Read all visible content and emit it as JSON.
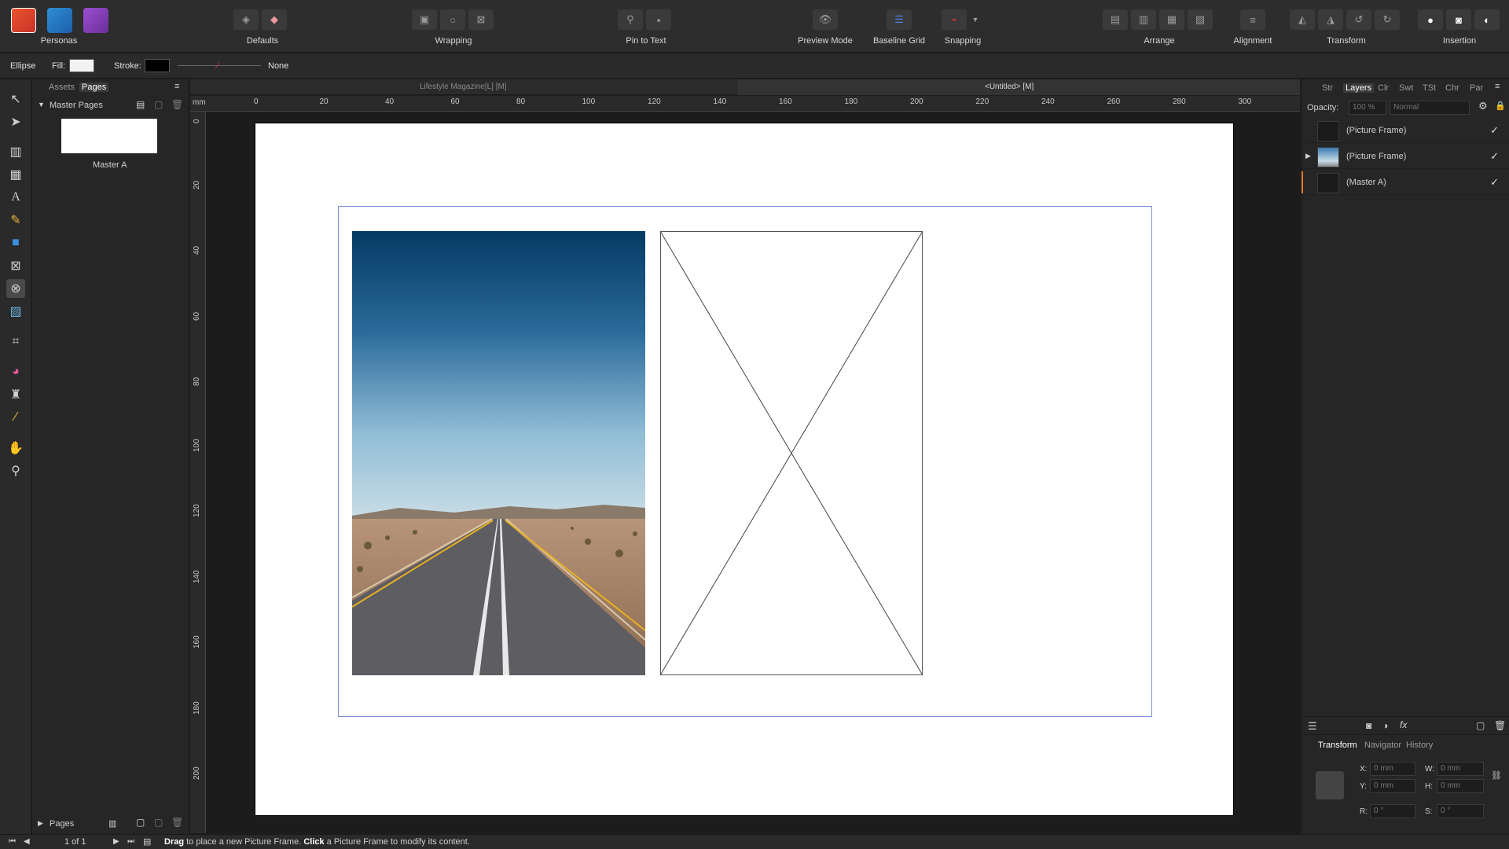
{
  "toolbar": {
    "personas_label": "Personas",
    "groups": {
      "defaults": "Defaults",
      "wrapping": "Wrapping",
      "pin_to_text": "Pin to Text",
      "preview_mode": "Preview Mode",
      "baseline_grid": "Baseline Grid",
      "snapping": "Snapping",
      "arrange": "Arrange",
      "alignment": "Alignment",
      "transform": "Transform",
      "insertion": "Insertion"
    }
  },
  "context": {
    "tool_name": "Ellipse",
    "fill_label": "Fill:",
    "stroke_label": "Stroke:",
    "stroke_style": "None",
    "fill_color": "#f2f2f2",
    "stroke_color": "#000000"
  },
  "left_panel": {
    "tabs": [
      "Assets",
      "Pages"
    ],
    "section_title": "Master Pages",
    "master_name": "Master A",
    "pages_section": "Pages",
    "page_count": "1 of 1"
  },
  "document_tabs": [
    "Lifestyle Magazine[L] [M]",
    "<Untitled> [M]"
  ],
  "ruler": {
    "unit": "mm",
    "h_ticks": [
      "0",
      "20",
      "40",
      "60",
      "80",
      "100",
      "120",
      "140",
      "160",
      "180",
      "200",
      "220",
      "240",
      "260",
      "280",
      "300"
    ],
    "v_ticks": [
      "0",
      "20",
      "40",
      "60",
      "80",
      "100",
      "120",
      "140",
      "160",
      "180",
      "200"
    ]
  },
  "right_panel": {
    "tabs": [
      "Str",
      "Layers",
      "Clr",
      "Swt",
      "TSt",
      "Chr",
      "Par"
    ],
    "active_tab": "Layers",
    "opacity_label": "Opacity:",
    "opacity_value": "100 %",
    "blend_mode": "Normal",
    "layers": [
      {
        "name": "(Picture Frame)",
        "visible": "✓"
      },
      {
        "name": "(Picture Frame)",
        "visible": "✓"
      },
      {
        "name": "(Master A)",
        "visible": "✓"
      }
    ],
    "bottom_tabs": [
      "Transform",
      "Navigator",
      "History"
    ],
    "transform": {
      "x_label": "X:",
      "x_value": "0 mm",
      "y_label": "Y:",
      "y_value": "0 mm",
      "w_label": "W:",
      "w_value": "0 mm",
      "h_label": "H:",
      "h_value": "0 mm",
      "r_label": "R:",
      "r_value": "0 °",
      "s_label": "S:",
      "s_value": "0 °"
    }
  },
  "status": {
    "drag_word": "Drag",
    "drag_text": "to place a new Picture Frame.",
    "click_word": "Click",
    "click_text": "a Picture Frame to modify its content."
  },
  "colors": {
    "accent": "#4a7fe0",
    "margin_guide": "#7a8fd8",
    "snapping_red": "#e0304a"
  }
}
